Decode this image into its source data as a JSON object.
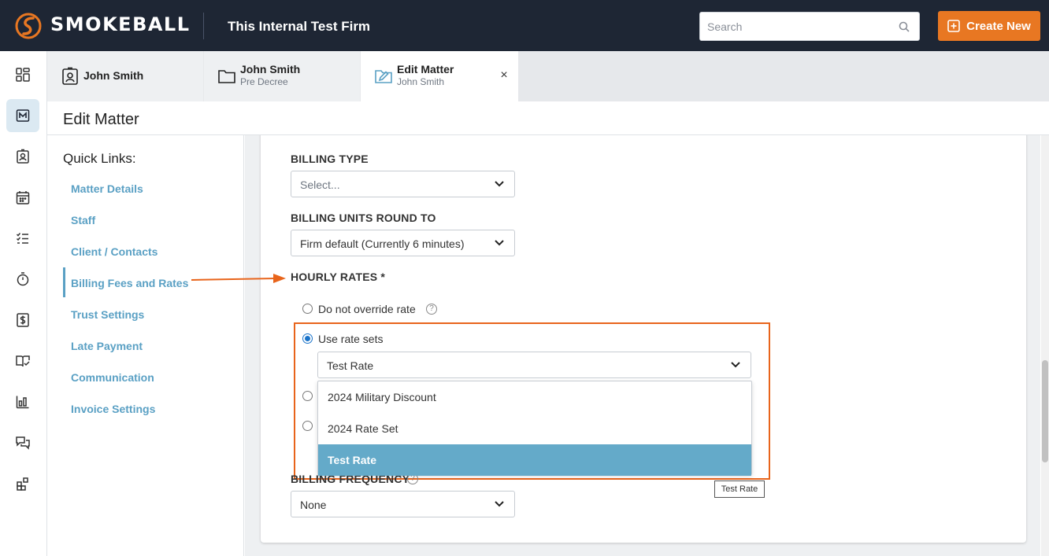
{
  "header": {
    "brand": "SMOKEBALL",
    "firm_name": "This Internal Test Firm",
    "search_placeholder": "Search",
    "create_label": "Create New"
  },
  "tabs": [
    {
      "title": "John Smith",
      "subtitle": ""
    },
    {
      "title": "John Smith",
      "subtitle": "Pre Decree"
    },
    {
      "title": "Edit Matter",
      "subtitle": "John Smith",
      "close": "×"
    }
  ],
  "page": {
    "title": "Edit Matter"
  },
  "quick_links": {
    "title": "Quick Links:",
    "items": [
      "Matter Details",
      "Staff",
      "Client / Contacts",
      "Billing Fees and Rates",
      "Trust Settings",
      "Late Payment",
      "Communication",
      "Invoice Settings"
    ],
    "active": "Billing Fees and Rates"
  },
  "form": {
    "billing_type": {
      "label": "BILLING TYPE",
      "value": "Select..."
    },
    "billing_units": {
      "label": "BILLING UNITS ROUND TO",
      "value": "Firm default (Currently 6 minutes)"
    },
    "hourly_rates": {
      "label": "HOURLY RATES *",
      "option_no_override": "Do not override rate",
      "option_rate_sets": "Use rate sets",
      "rate_set_value": "Test Rate",
      "dropdown_options": [
        "2024 Military Discount",
        "2024 Rate Set",
        "Test Rate"
      ],
      "selected_option": "Test Rate",
      "help": "?"
    },
    "billing_frequency": {
      "label": "BILLING FREQUENCY",
      "value": "None",
      "help": "?"
    }
  },
  "tooltip": "Test Rate",
  "colors": {
    "accent": "#e87722",
    "link": "#5aa0c4",
    "topbar": "#1e2634",
    "selected": "#64aac9",
    "annotation": "#e8641b"
  }
}
